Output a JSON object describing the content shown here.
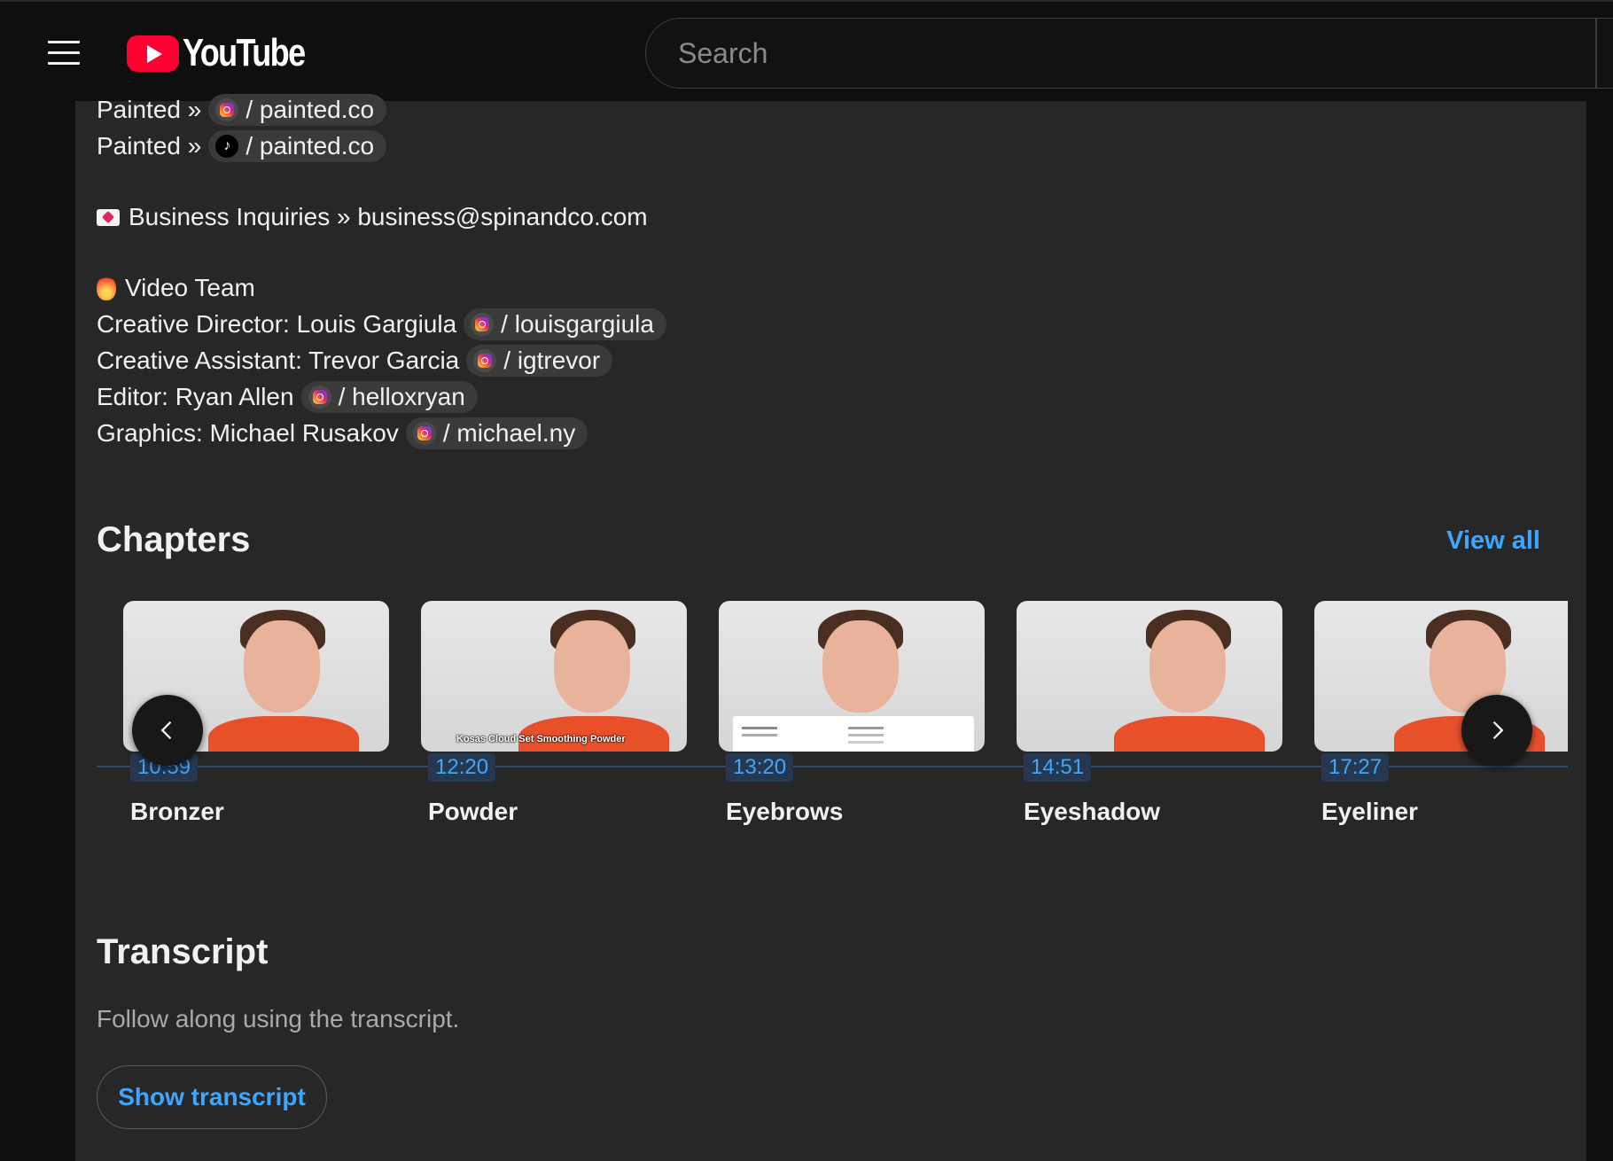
{
  "header": {
    "logo_text": "YouTube",
    "search_placeholder": "Search"
  },
  "description": {
    "social_lines": [
      {
        "prefix": "Painted »",
        "icon": "instagram-icon",
        "handle": "/ painted.co"
      },
      {
        "prefix": "Painted »",
        "icon": "tiktok-icon",
        "handle": "/ painted.co"
      }
    ],
    "business": "Business Inquiries » business@spinandco.com",
    "video_team_heading": "Video Team",
    "team": [
      {
        "role": "Creative Director: Louis Gargiula",
        "handle": "/ louisgargiula"
      },
      {
        "role": "Creative Assistant: Trevor Garcia",
        "handle": "/ igtrevor"
      },
      {
        "role": "Editor: Ryan Allen",
        "handle": "/ helloxryan"
      },
      {
        "role": "Graphics: Michael Rusakov",
        "handle": "/ michael.ny"
      }
    ]
  },
  "chapters": {
    "title": "Chapters",
    "view_all": "View all",
    "items": [
      {
        "time": "10:59",
        "title": "Bronzer"
      },
      {
        "time": "12:20",
        "title": "Powder",
        "overlay": "Kosas Cloud Set Smoothing Powder"
      },
      {
        "time": "13:20",
        "title": "Eyebrows"
      },
      {
        "time": "14:51",
        "title": "Eyeshadow"
      },
      {
        "time": "17:27",
        "title": "Eyeliner"
      }
    ]
  },
  "transcript": {
    "title": "Transcript",
    "subtitle": "Follow along using the transcript.",
    "button": "Show transcript"
  },
  "colors": {
    "accent": "#3ea6ff",
    "brand_red": "#ff0033",
    "panel_bg": "#272727",
    "page_bg": "#0f0f0f"
  }
}
